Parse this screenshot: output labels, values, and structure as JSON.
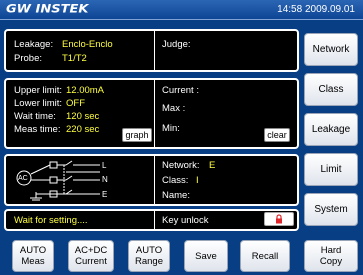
{
  "header": {
    "logo": "GW INSTEK",
    "clock": "14:58  2009.09.01"
  },
  "info": {
    "leakage_label": "Leakage:",
    "leakage_value": "Enclo-Enclo",
    "probe_label": "Probe:",
    "probe_value": "T1/T2",
    "judge_label": "Judge:"
  },
  "settings": {
    "upper_limit_label": "Upper limit:",
    "upper_limit_value": "12.00mA",
    "lower_limit_label": "Lower limit:",
    "lower_limit_value": "OFF",
    "wait_time_label": "Wait time:",
    "wait_time_value": "120 sec",
    "meas_time_label": "Meas time:",
    "meas_time_value": "220 sec",
    "graph_button": "graph"
  },
  "readings": {
    "current_label": "Current :",
    "max_label": "Max :",
    "min_label": "Min:",
    "clear_button": "clear"
  },
  "circuit": {
    "source_label": "AC",
    "terminal_l": "L",
    "terminal_n": "N",
    "terminal_e": "E",
    "network_label": "Network:",
    "network_value": "E",
    "class_label": "Class:",
    "class_value": "I",
    "name_label": "Name:"
  },
  "status": {
    "message": "Wait for setting....",
    "key_label": "Key unlock",
    "lock_icon": "lock-icon",
    "lock_color": "#e0262b"
  },
  "side_menu": [
    {
      "label": "Network"
    },
    {
      "label": "Class"
    },
    {
      "label": "Leakage"
    },
    {
      "label": "Limit"
    },
    {
      "label": "System"
    }
  ],
  "bottom_menu": [
    {
      "line1": "AUTO",
      "line2": "Meas"
    },
    {
      "line1": "AC+DC",
      "line2": "Current"
    },
    {
      "line1": "AUTO",
      "line2": "Range"
    },
    {
      "line1": "Save",
      "line2": ""
    },
    {
      "line1": "Recall",
      "line2": ""
    },
    {
      "line1": "Hard",
      "line2": "Copy"
    }
  ],
  "colors": {
    "background": "#083f84",
    "value_text": "#ffff40",
    "panel": "#000000"
  }
}
